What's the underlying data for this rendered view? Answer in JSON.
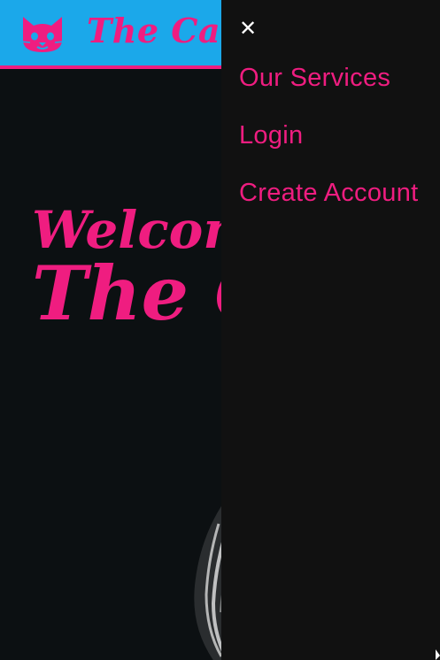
{
  "header": {
    "brand_text": "The Cat Sp",
    "logo_icon": "cat-face-icon"
  },
  "hero": {
    "line1": "Welcome T",
    "line2": "The Ca"
  },
  "drawer": {
    "close_icon": "close-icon",
    "close_glyph": "✕",
    "items": [
      {
        "label": "Our Services"
      },
      {
        "label": "Login"
      },
      {
        "label": "Create Account"
      }
    ]
  },
  "colors": {
    "header_bg": "#1ba8ea",
    "accent": "#ef1d80",
    "page_bg": "#0c1012",
    "drawer_bg": "#111111"
  }
}
